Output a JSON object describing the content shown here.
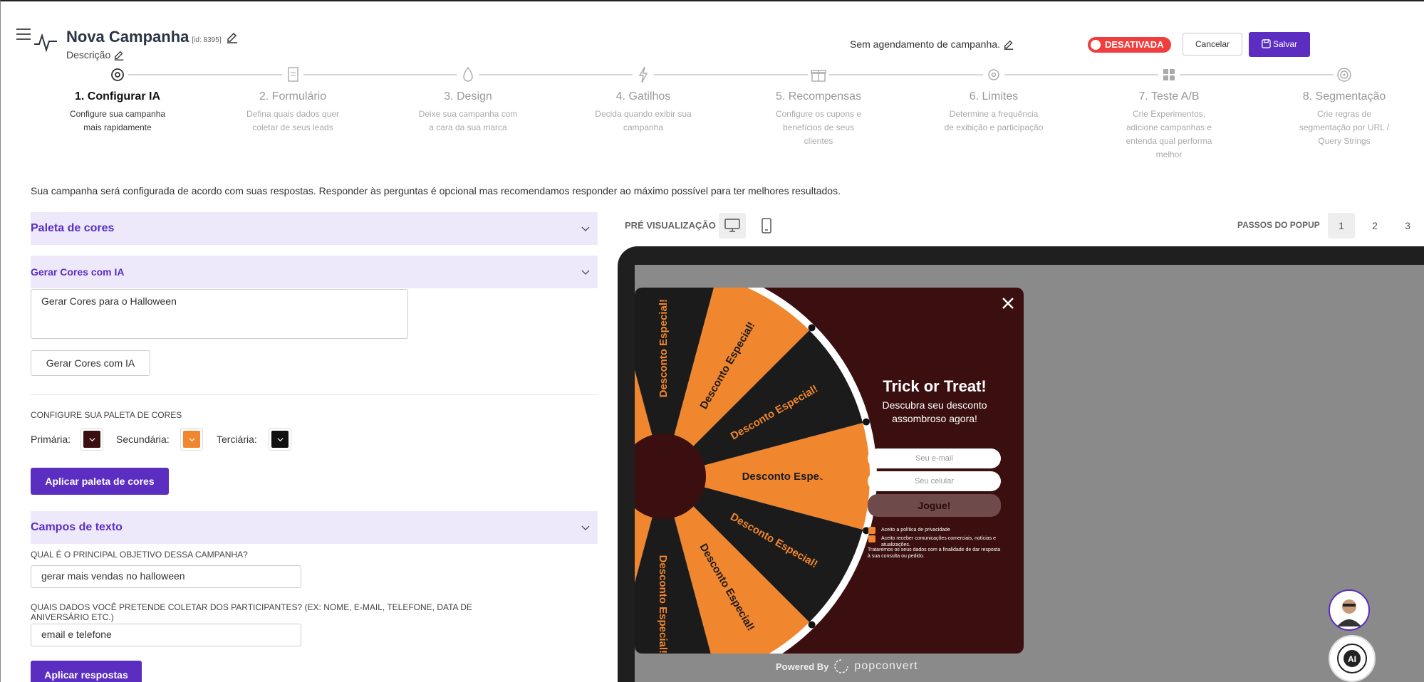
{
  "header": {
    "title": "Nova Campanha",
    "campaign_id": "[id: 8395]",
    "description": "Descrição",
    "schedule": "Sem agendamento de campanha.",
    "status": "DESATIVADA",
    "cancel_label": "Cancelar",
    "save_label": "Salvar"
  },
  "steps": [
    {
      "title": "1. Configurar IA",
      "desc": "Configure sua campanha mais rapidamente",
      "icon": "gear-icon"
    },
    {
      "title": "2. Formulário",
      "desc": "Defina quais dados quer coletar de seus leads",
      "icon": "form-icon"
    },
    {
      "title": "3. Design",
      "desc": "Deixe sua campanha com a cara da sua marca",
      "icon": "drop-icon"
    },
    {
      "title": "4. Gatilhos",
      "desc": "Decida quando exibir sua campanha",
      "icon": "lightning-icon"
    },
    {
      "title": "5. Recompensas",
      "desc": "Configure os cupons e benefícios de seus clientes",
      "icon": "gift-icon"
    },
    {
      "title": "6. Limites",
      "desc": "Determine a frequência de exibição e participação",
      "icon": "cog-icon"
    },
    {
      "title": "7. Teste A/B",
      "desc": "Crie Experimentos, adicione campanhas e entenda qual performa melhor",
      "icon": "grid-icon"
    },
    {
      "title": "8. Segmentação",
      "desc": "Crie regras de segmentação por URL / Query Strings",
      "icon": "target-icon"
    }
  ],
  "intro": "Sua campanha será configurada de acordo com suas respostas. Responder às perguntas é opcional mas recomendamos responder ao máximo possível para ter melhores resultados.",
  "palette": {
    "section_label": "Paleta de cores",
    "ai_section_label": "Gerar Cores com IA",
    "ai_prompt": "Gerar Cores para o Halloween",
    "ai_button": "Gerar Cores com IA",
    "config_label": "CONFIGURE SUA PALETA DE CORES",
    "primary_label": "Primária:",
    "secondary_label": "Secundária:",
    "tertiary_label": "Terciária:",
    "primary_color": "#3b0f10",
    "secondary_color": "#f0862e",
    "tertiary_color": "#111111",
    "apply_button": "Aplicar paleta de cores"
  },
  "text_fields": {
    "section_label": "Campos de texto",
    "q1_label": "QUAL É O PRINCIPAL OBJETIVO DESSA CAMPANHA?",
    "q1_value": "gerar mais vendas no halloween",
    "q2_label": "QUAIS DADOS VOCÊ PRETENDE COLETAR DOS PARTICIPANTES? (EX: NOME, E-MAIL, TELEFONE, DATA DE ANIVERSÁRIO ETC.)",
    "q2_value": "email e telefone",
    "apply_button": "Aplicar respostas"
  },
  "preview": {
    "label": "PRÉ VISUALIZAÇÃO",
    "steps_label": "PASSOS DO POPUP",
    "steps": [
      "1",
      "2",
      "3"
    ],
    "popup": {
      "title": "Trick or Treat!",
      "subtitle": "Descubra seu desconto assombroso agora!",
      "email_placeholder": "Seu e-mail",
      "phone_placeholder": "Seu celular",
      "cta": "Jogue!",
      "check1": "Aceito a política de privacidade",
      "check2": "Aceito receber comunicações comerciais, notícias e atualizações.",
      "privacy": "Trataremos os seus dados com a finalidade de dar resposta à sua consulta ou pedido.",
      "wheel_label": "Desconto Especial!",
      "wheel_label_partial": "Desco",
      "wheel_colors": [
        "#f0862e",
        "#1b1b1b"
      ],
      "powered_by": "Powered By",
      "brand": "popconvert"
    }
  }
}
